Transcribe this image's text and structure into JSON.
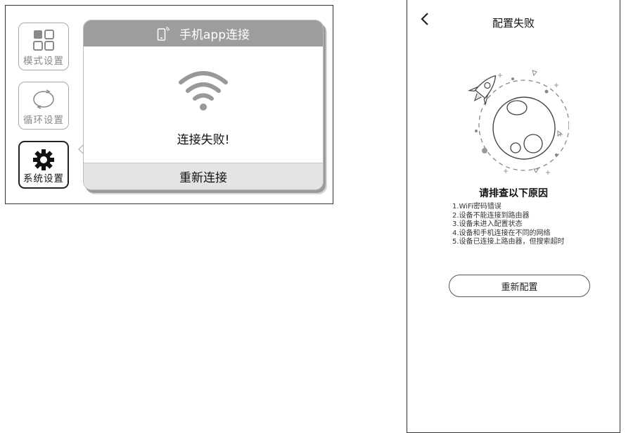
{
  "device": {
    "sidebar": [
      {
        "label": "模式设置",
        "icon": "grid-icon",
        "active": false
      },
      {
        "label": "循环设置",
        "icon": "cycle-icon",
        "active": false
      },
      {
        "label": "系统设置",
        "icon": "gear-icon",
        "active": true
      }
    ],
    "dialog": {
      "title": "手机app连接",
      "title_icon": "phone-icon",
      "status_icon": "wifi-icon",
      "message": "连接失败!",
      "retry_label": "重新连接"
    }
  },
  "app": {
    "title": "配置失败",
    "back_icon": "chevron-left-icon",
    "illustration": "rocket-planet-illustration",
    "reasons_title": "请排查以下原因",
    "reasons": [
      "1.WiFi密码错误",
      "2.设备不能连接到路由器",
      "3.设备未进入配置状态",
      "4.设备和手机连接在不同的网络",
      "5.设备已连接上路由器，但搜索超时"
    ],
    "reconfigure_label": "重新配置"
  },
  "colors": {
    "dialog_header": "#9d9d9d",
    "dialog_footer": "#e4e4e4",
    "border": "#333333"
  }
}
